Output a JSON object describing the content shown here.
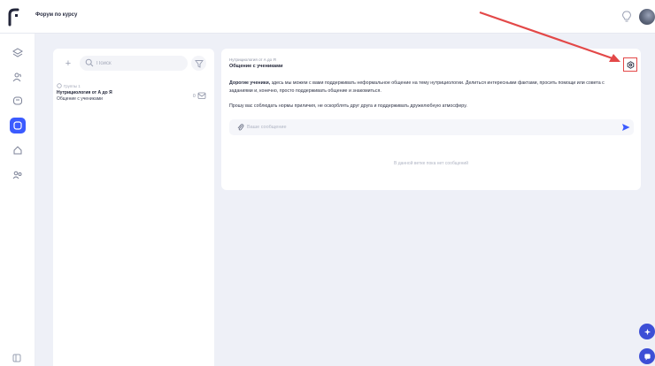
{
  "header": {
    "title": "Форум по курсу"
  },
  "sidebar": {
    "items": [
      {
        "icon": "layers-icon",
        "active": false
      },
      {
        "icon": "users-icon",
        "active": false
      },
      {
        "icon": "chat-bubble-icon",
        "active": false
      },
      {
        "icon": "forum-icon",
        "active": true
      },
      {
        "icon": "home-icon",
        "active": false
      },
      {
        "icon": "user-group-icon",
        "active": false
      }
    ]
  },
  "list": {
    "search_placeholder": "Поиск",
    "group": {
      "meta": "Группы 1",
      "name": "Нутрициология от А до Я",
      "subtitle": "Общение с учениками",
      "unread_count": "0"
    }
  },
  "chat": {
    "breadcrumb": "Нутрициология от А до Я",
    "title": "Общение с учениками",
    "greeting": "Дорогие ученики,",
    "description": " здесь мы можем с вами поддерживать неформальное общение на тему нутрициологии. Делиться интересными фактами, просить помощи или совета с заданиями и, конечно, просто поддерживать общение и знакомиться.",
    "rules": "Прошу вас соблюдать нормы приличия, не оскорблять друг друга и поддерживать дружелюбную атмосферу.",
    "message_placeholder": "Ваше сообщение",
    "empty_state": "В данной ветке пока нет сообщений"
  },
  "colors": {
    "accent": "#3b5bff",
    "annotation_arrow": "#e34848",
    "background": "#eef0f7"
  }
}
